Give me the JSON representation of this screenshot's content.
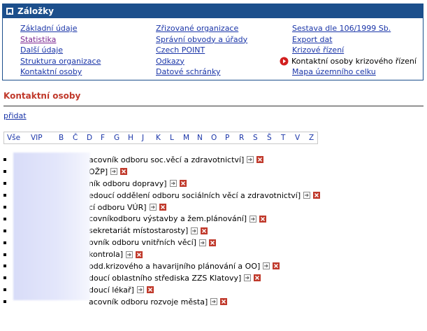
{
  "panel": {
    "title": "Záložky",
    "col1": [
      "Základní údaje",
      "Statistika",
      "Další údaje",
      "Struktura organizace",
      "Kontaktní osoby"
    ],
    "col2": [
      "Zřizované organizace",
      "Správní obvody a úřady",
      "Czech POINT",
      "Odkazy",
      "Datové schránky"
    ],
    "col3": [
      "Sestava dle 106/1999 Sb.",
      "Export dat",
      "Krizové řízení"
    ],
    "current": "Kontaktní osoby krizového řízení",
    "col3_last": "Mapa územního celku"
  },
  "section_title": "Kontaktní osoby",
  "add_label": "přidat",
  "alphabet": [
    "Vše",
    "VIP",
    "B",
    "Č",
    "D",
    "F",
    "G",
    "H",
    "J",
    "K",
    "L",
    "M",
    "N",
    "O",
    "P",
    "R",
    "S",
    "Š",
    "T",
    "V",
    "Z"
  ],
  "contacts": [
    "acovník odboru soc.věcí a zdravotnictví]",
    "OŽP]",
    "ník odboru dopravy]",
    "edoucí oddělení odboru sociálních věcí a zdravotnictví]",
    "cí odboru VÚR]",
    "covníkodboru výstavby a žem.plánování]",
    "sekretariát místostarosty]",
    "ovník odboru vnitřních věcí]",
    "kontrola]",
    "odd.krizového a havarijního plánování a OO]",
    "doucí oblastního střediska ZZS Klatovy]",
    "doucí lékař]",
    "acovník odboru rozvoje města]"
  ],
  "colors": {
    "header": "#1c4f8c",
    "link": "#1a35a8",
    "visited": "#7a2590",
    "title": "#c0392b",
    "delete": "#c0392b"
  }
}
